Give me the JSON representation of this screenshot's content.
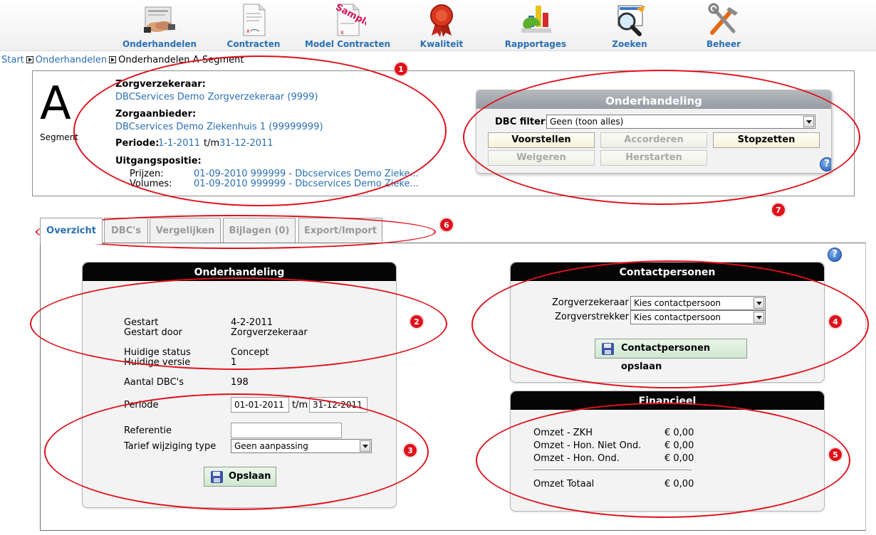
{
  "nav": [
    {
      "label": "Onderhandelen",
      "icon": "handshake-icon"
    },
    {
      "label": "Contracten",
      "icon": "document-icon"
    },
    {
      "label": "Model Contracten",
      "icon": "sample-document-icon",
      "stamp": "Sample"
    },
    {
      "label": "Kwaliteit",
      "icon": "quality-seal-icon"
    },
    {
      "label": "Rapportages",
      "icon": "chart-report-icon"
    },
    {
      "label": "Zoeken",
      "icon": "magnifier-icon"
    },
    {
      "label": "Beheer",
      "icon": "tools-icon"
    }
  ],
  "breadcrumb": {
    "items": [
      "Start",
      "Onderhandelen"
    ],
    "current": "Onderhandelen A-Segment"
  },
  "header": {
    "segment_letter": "A",
    "segment_word": "Segment",
    "zorgverzekeraar_label": "Zorgverzekeraar:",
    "zorgverzekeraar_value": "DBCServices Demo Zorgverzekeraar (9999)",
    "zorgaanbieder_label": "Zorgaanbieder:",
    "zorgaanbieder_value": "DBCservices Demo Ziekenhuis 1 (99999999)",
    "periode_label": "Periode:",
    "periode_from": "1-1-2011",
    "periode_sep": "t/m",
    "periode_to": "31-12-2011",
    "uitgang_label": "Uitgangspositie:",
    "prijzen_label": "Prijzen:",
    "prijzen_value": "01-09-2010 999999 - Dbcservices Demo Zieke...",
    "volumes_label": "Volumes:",
    "volumes_value": "01-09-2010 999999 - Dbcservices Demo Zieke..."
  },
  "onderhandeling_panel": {
    "title": "Onderhandeling",
    "filter_label": "DBC filter:",
    "filter_value": "Geen (toon alles)",
    "buttons": {
      "voorstellen": "Voorstellen",
      "accorderen": "Accorderen",
      "stopzetten": "Stopzetten",
      "weigeren": "Weigeren",
      "herstarten": "Herstarten"
    }
  },
  "tabs": [
    {
      "label": "Overzicht",
      "active": true
    },
    {
      "label": "DBC's",
      "active": false
    },
    {
      "label": "Vergelijken",
      "active": false
    },
    {
      "label": "Bijlagen (0)",
      "active": false
    },
    {
      "label": "Export/Import",
      "active": false
    }
  ],
  "overzicht": {
    "title": "Onderhandeling",
    "gestart_label": "Gestart",
    "gestart_value": "4-2-2011",
    "gestart_door_label": "Gestart door",
    "gestart_door_value": "Zorgverzekeraar",
    "status_label": "Huidige status",
    "status_value": "Concept",
    "versie_label": "Huidige versie",
    "versie_value": "1",
    "aantal_label": "Aantal DBC's",
    "aantal_value": "198",
    "periode_label": "Periode",
    "periode_from": "01-01-2011",
    "periode_sep": "t/m",
    "periode_to": "31-12-2011",
    "referentie_label": "Referentie",
    "referentie_value": "",
    "tarief_label": "Tarief wijziging type",
    "tarief_value": "Geen aanpassing",
    "save_label": "Opslaan"
  },
  "contact": {
    "title": "Contactpersonen",
    "zorgverzekeraar_label": "Zorgverzekeraar",
    "zorgverzekeraar_value": "Kies contactpersoon",
    "zorgverstrekker_label": "Zorgverstrekker",
    "zorgverstrekker_value": "Kies contactpersoon",
    "save_label": "Contactpersonen opslaan"
  },
  "financieel": {
    "title": "Financieel",
    "rows": [
      {
        "label": "Omzet - ZKH",
        "value": "€ 0,00"
      },
      {
        "label": "Omzet - Hon. Niet Ond.",
        "value": "€ 0,00"
      },
      {
        "label": "Omzet - Hon. Ond.",
        "value": "€ 0,00"
      }
    ],
    "total_label": "Omzet Totaal",
    "total_value": "€ 0,00"
  },
  "annotations": [
    "1",
    "2",
    "3",
    "4",
    "5",
    "6",
    "7"
  ],
  "colors": {
    "link": "#2a6fb5",
    "annotation": "#e0101b",
    "panel_title": "#050505"
  }
}
